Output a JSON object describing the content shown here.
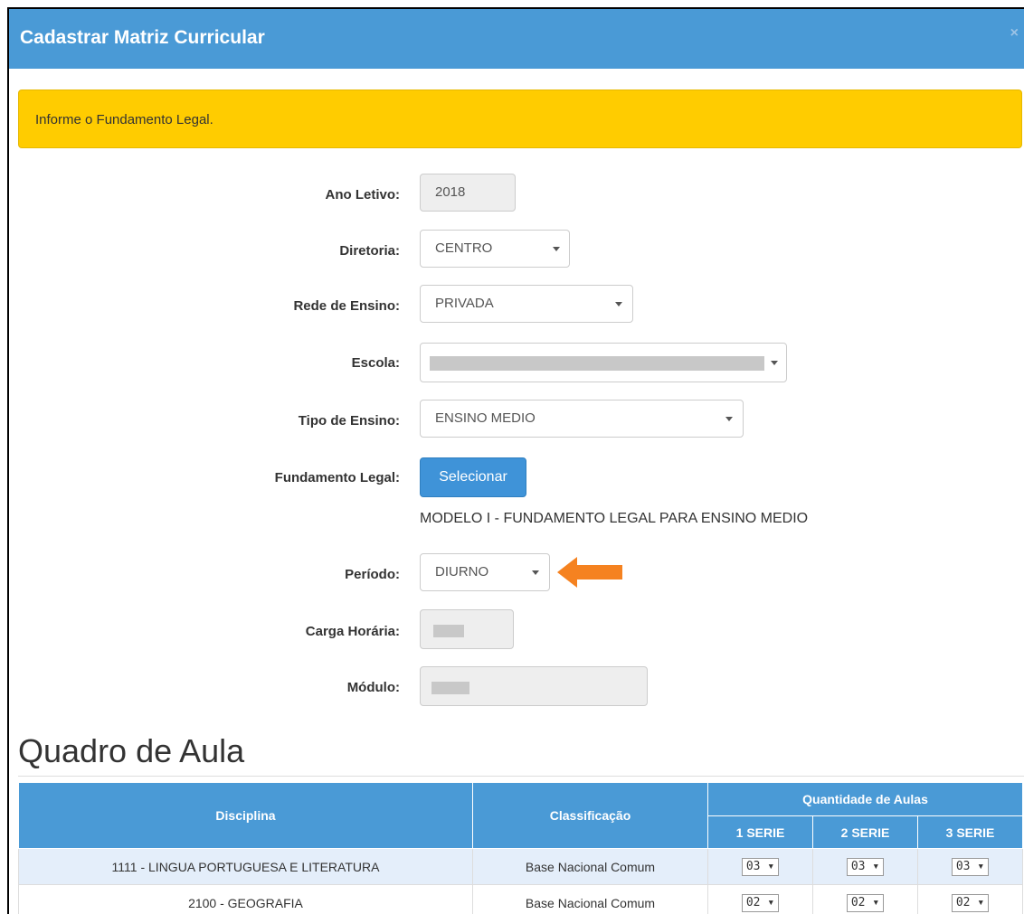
{
  "modal": {
    "title": "Cadastrar Matriz Curricular",
    "close": "×"
  },
  "alert": {
    "message": "Informe o Fundamento Legal."
  },
  "form": {
    "ano_letivo": {
      "label": "Ano Letivo:",
      "value": "2018"
    },
    "diretoria": {
      "label": "Diretoria:",
      "value": "CENTRO"
    },
    "rede_ensino": {
      "label": "Rede de Ensino:",
      "value": "PRIVADA"
    },
    "escola": {
      "label": "Escola:"
    },
    "tipo_ensino": {
      "label": "Tipo de Ensino:",
      "value": "ENSINO MEDIO"
    },
    "fundamento_legal": {
      "label": "Fundamento Legal:",
      "button": "Selecionar",
      "text": "MODELO I - FUNDAMENTO LEGAL PARA ENSINO MEDIO"
    },
    "periodo": {
      "label": "Período:",
      "value": "DIURNO"
    },
    "carga_horaria": {
      "label": "Carga Horária:"
    },
    "modulo": {
      "label": "Módulo:"
    }
  },
  "quadro": {
    "title": "Quadro de Aula",
    "headers": {
      "disciplina": "Disciplina",
      "classificacao": "Classificação",
      "quantidade": "Quantidade de Aulas",
      "series": [
        "1 SERIE",
        "2 SERIE",
        "3 SERIE"
      ]
    },
    "rows": [
      {
        "disciplina": "1111 - LINGUA PORTUGUESA E LITERATURA",
        "classificacao": "Base Nacional Comum",
        "aulas": [
          "03 ▾",
          "03 ▾",
          "03 ▾"
        ]
      },
      {
        "disciplina": "2100 - GEOGRAFIA",
        "classificacao": "Base Nacional Comum",
        "aulas": [
          "02 ▾",
          "02 ▾",
          "02 ▾"
        ]
      }
    ]
  },
  "colors": {
    "header": "#4a9ad6",
    "alert": "#ffcc00",
    "button": "#3f93d8",
    "arrow": "#f58220"
  }
}
